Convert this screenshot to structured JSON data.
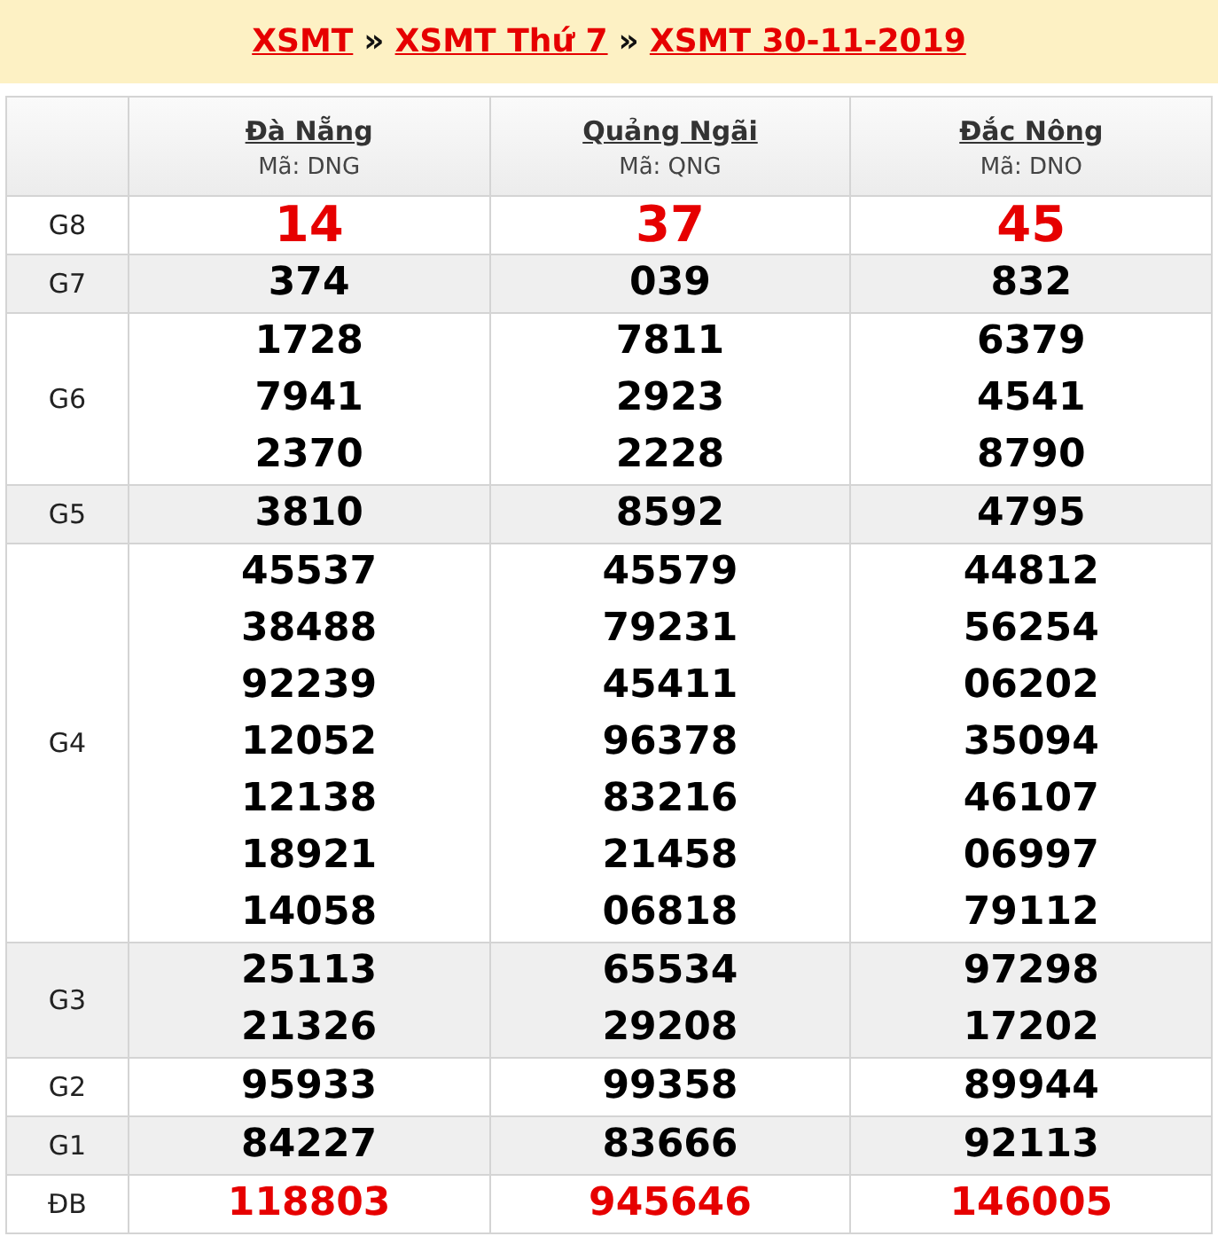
{
  "breadcrumb": [
    {
      "kind": "link",
      "text": "XSMT"
    },
    {
      "kind": "separator",
      "text": "»"
    },
    {
      "kind": "link",
      "text": "XSMT Thứ 7"
    },
    {
      "kind": "separator",
      "text": "»"
    },
    {
      "kind": "link",
      "text": "XSMT 30-11-2019"
    }
  ],
  "provinces": [
    {
      "name": "Đà Nẵng",
      "code": "Mã: DNG"
    },
    {
      "name": "Quảng Ngãi",
      "code": "Mã: QNG"
    },
    {
      "name": "Đắc Nông",
      "code": "Mã: DNO"
    }
  ],
  "prizes": [
    {
      "label": "G8",
      "kind": "big",
      "shaded": false,
      "results": [
        [
          "14"
        ],
        [
          "37"
        ],
        [
          "45"
        ]
      ]
    },
    {
      "label": "G7",
      "kind": "normal",
      "shaded": true,
      "results": [
        [
          "374"
        ],
        [
          "039"
        ],
        [
          "832"
        ]
      ]
    },
    {
      "label": "G6",
      "kind": "normal",
      "shaded": false,
      "results": [
        [
          "1728",
          "7941",
          "2370"
        ],
        [
          "7811",
          "2923",
          "2228"
        ],
        [
          "6379",
          "4541",
          "8790"
        ]
      ]
    },
    {
      "label": "G5",
      "kind": "normal",
      "shaded": true,
      "results": [
        [
          "3810"
        ],
        [
          "8592"
        ],
        [
          "4795"
        ]
      ]
    },
    {
      "label": "G4",
      "kind": "normal",
      "shaded": false,
      "results": [
        [
          "45537",
          "38488",
          "92239",
          "12052",
          "12138",
          "18921",
          "14058"
        ],
        [
          "45579",
          "79231",
          "45411",
          "96378",
          "83216",
          "21458",
          "06818"
        ],
        [
          "44812",
          "56254",
          "06202",
          "35094",
          "46107",
          "06997",
          "79112"
        ]
      ]
    },
    {
      "label": "G3",
      "kind": "normal",
      "shaded": true,
      "results": [
        [
          "25113",
          "21326"
        ],
        [
          "65534",
          "29208"
        ],
        [
          "97298",
          "17202"
        ]
      ]
    },
    {
      "label": "G2",
      "kind": "normal",
      "shaded": false,
      "results": [
        [
          "95933"
        ],
        [
          "99358"
        ],
        [
          "89944"
        ]
      ]
    },
    {
      "label": "G1",
      "kind": "normal",
      "shaded": true,
      "results": [
        [
          "84227"
        ],
        [
          "83666"
        ],
        [
          "92113"
        ]
      ]
    },
    {
      "label": "ĐB",
      "kind": "special",
      "shaded": false,
      "results": [
        [
          "118803"
        ],
        [
          "945646"
        ],
        [
          "146005"
        ]
      ]
    }
  ]
}
